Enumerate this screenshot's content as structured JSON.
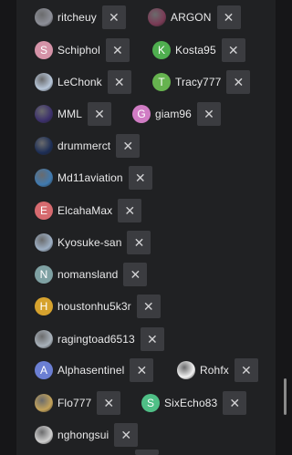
{
  "remove_symbol": "✕",
  "rows": [
    [
      {
        "name": "ritcheuy",
        "avatar": "photo",
        "color": "#8d8f98"
      },
      {
        "name": "ARGON",
        "avatar": "photo",
        "color": "#7a3a55"
      }
    ],
    [
      {
        "name": "Schiphol",
        "avatar": "S",
        "color": "#d593a8"
      },
      {
        "name": "Kosta95",
        "avatar": "K",
        "color": "#4fae4f"
      }
    ],
    [
      {
        "name": "LeChonk",
        "avatar": "photo",
        "color": "#b8c7da"
      },
      {
        "name": "Tracy777",
        "avatar": "T",
        "color": "#66b34f"
      }
    ],
    [
      {
        "name": "MML",
        "avatar": "photo",
        "color": "#3b2f6b"
      },
      {
        "name": "giam96",
        "avatar": "G",
        "color": "#d07cc4"
      }
    ],
    [
      {
        "name": "drummerct",
        "avatar": "photo",
        "color": "#1c2d55"
      }
    ],
    [
      {
        "name": "Md11aviation",
        "avatar": "photo",
        "color": "#3f7ab0"
      }
    ],
    [
      {
        "name": "ElcahaMax",
        "avatar": "E",
        "color": "#d66a6f"
      }
    ],
    [
      {
        "name": "Kyosuke-san",
        "avatar": "photo",
        "color": "#9eb0c5"
      }
    ],
    [
      {
        "name": "nomansland",
        "avatar": "N",
        "color": "#7fa1a3"
      }
    ],
    [
      {
        "name": "houstonhu5k3r",
        "avatar": "H",
        "color": "#d6a22e"
      }
    ],
    [
      {
        "name": "ragingtoad6513",
        "avatar": "photo",
        "color": "#a9b2bb"
      }
    ],
    [
      {
        "name": "Alphasentinel",
        "avatar": "A",
        "color": "#6b7fd3"
      },
      {
        "name": "Rohfx",
        "avatar": "photo",
        "color": "#f2f2f2"
      }
    ],
    [
      {
        "name": "Flo777",
        "avatar": "photo",
        "color": "#c4a35a"
      },
      {
        "name": "SixEcho83",
        "avatar": "S",
        "color": "#4fbf86"
      }
    ],
    [
      {
        "name": "nghongsui",
        "avatar": "photo",
        "color": "#d0d0d0"
      }
    ]
  ]
}
